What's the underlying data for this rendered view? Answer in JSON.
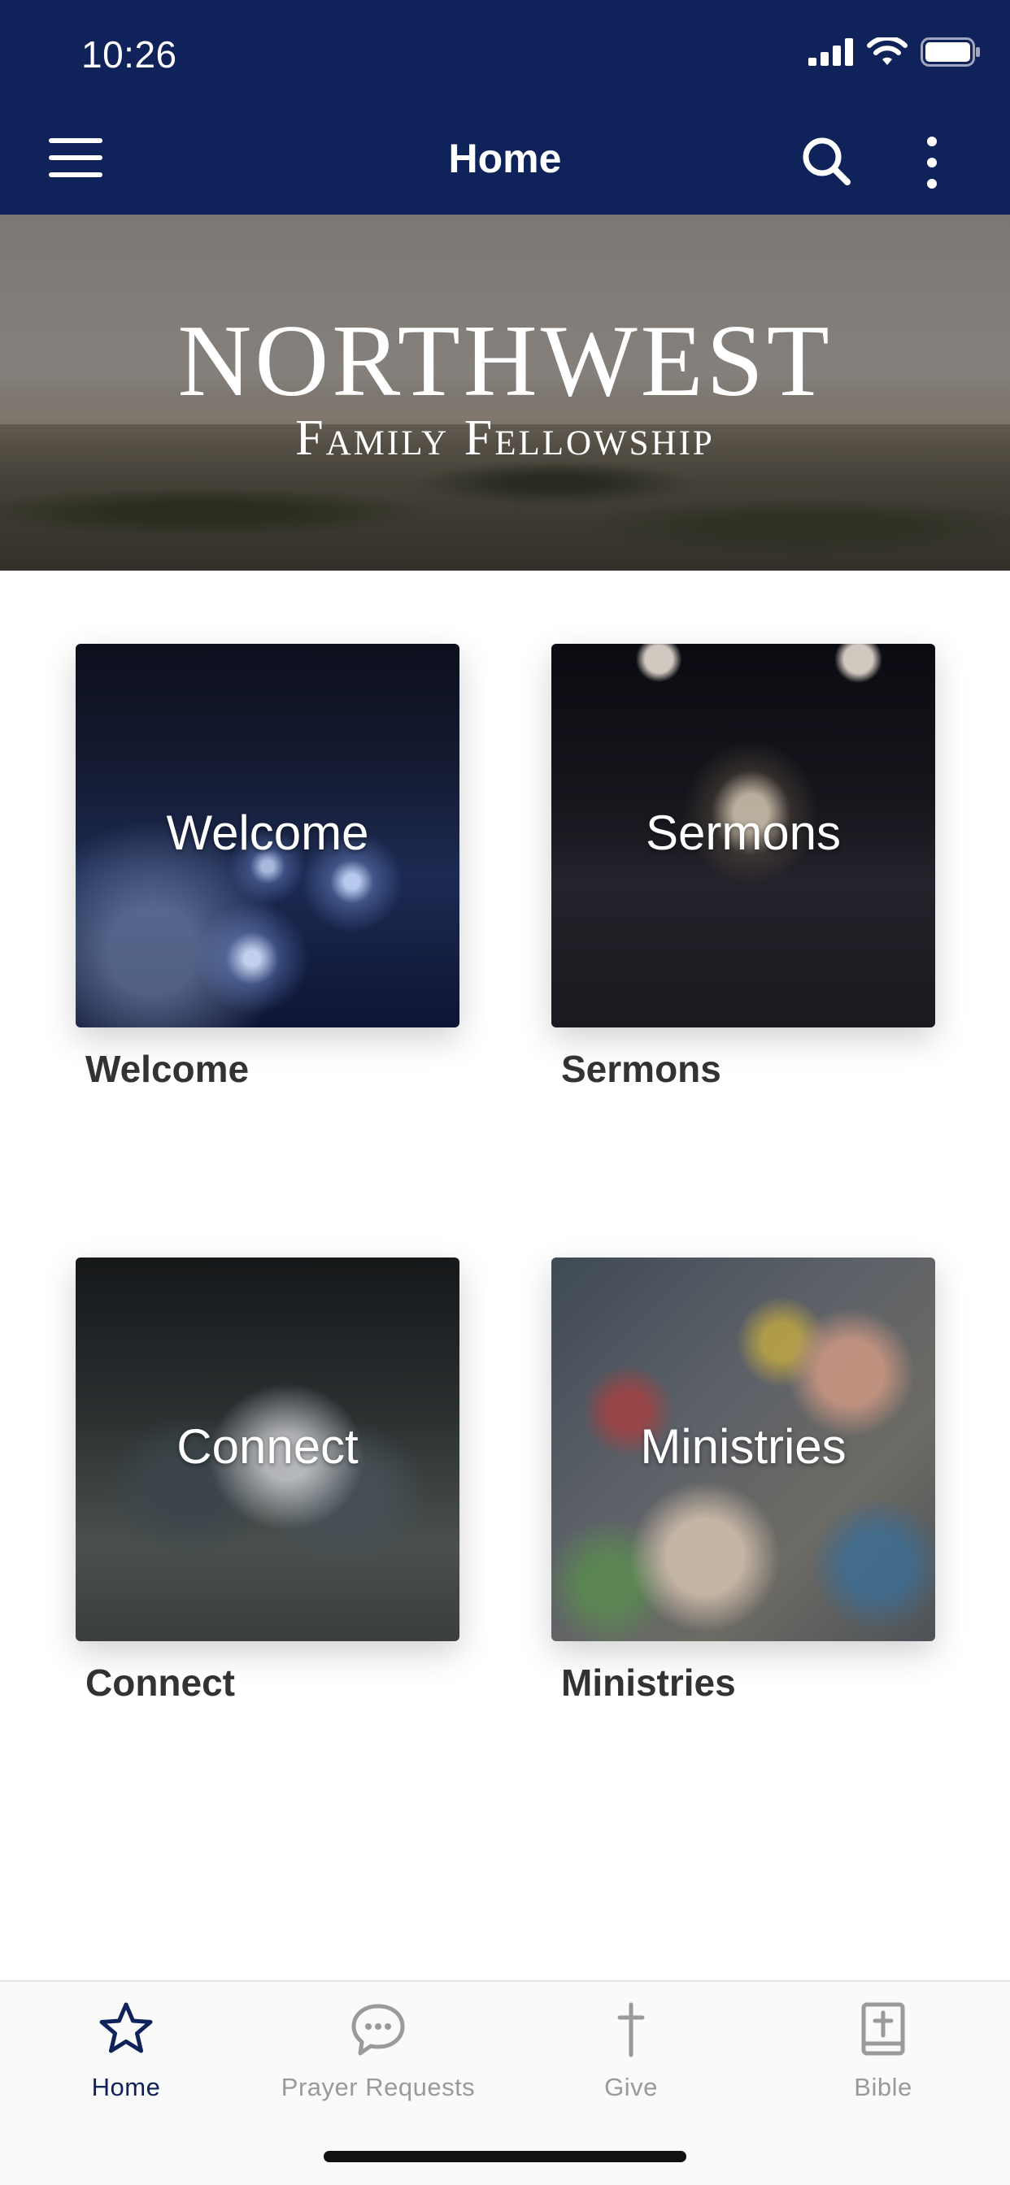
{
  "status_bar": {
    "time": "10:26"
  },
  "header": {
    "title": "Home"
  },
  "banner": {
    "title": "NORTHWEST",
    "subtitle": "Family Fellowship"
  },
  "tiles": [
    {
      "overlay": "Welcome",
      "caption": "Welcome"
    },
    {
      "overlay": "Sermons",
      "caption": "Sermons"
    },
    {
      "overlay": "Connect",
      "caption": "Connect"
    },
    {
      "overlay": "Ministries",
      "caption": "Ministries"
    }
  ],
  "tabs": [
    {
      "label": "Home",
      "icon": "star-icon",
      "active": true
    },
    {
      "label": "Prayer Requests",
      "icon": "chat-bubble-icon",
      "active": false
    },
    {
      "label": "Give",
      "icon": "cross-icon",
      "active": false
    },
    {
      "label": "Bible",
      "icon": "bible-icon",
      "active": false
    }
  ],
  "colors": {
    "header": "#10225a",
    "active_tab": "#10225a",
    "inactive_tab": "#9a9a9a"
  }
}
